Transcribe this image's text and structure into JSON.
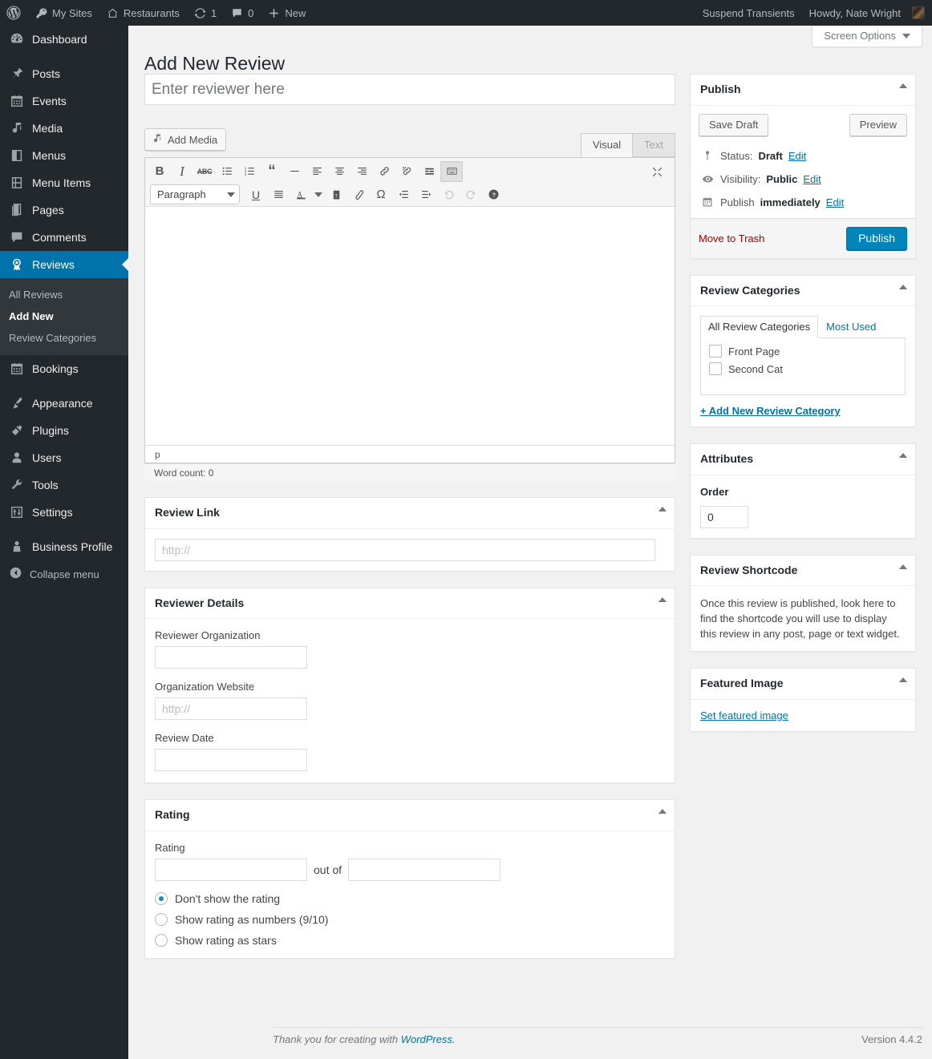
{
  "adminbar": {
    "logo_icon": "wordpress-logo-icon",
    "left_items": [
      {
        "label": "My Sites",
        "icon": "key-icon"
      },
      {
        "label": "Restaurants",
        "icon": "home-icon"
      },
      {
        "label": "1",
        "icon": "updates-icon"
      },
      {
        "label": "0",
        "icon": "comment-bubble-icon"
      },
      {
        "label": "New",
        "icon": "plus-icon"
      }
    ],
    "right_items": [
      {
        "label": "Suspend Transients"
      },
      {
        "label": "Howdy, Nate Wright"
      }
    ],
    "avatar_alt": "avatar"
  },
  "sidebar": {
    "items": [
      {
        "label": "Dashboard",
        "icon": "dashboard-icon",
        "current": false
      },
      {
        "label": "Posts",
        "icon": "pin-icon",
        "current": false
      },
      {
        "label": "Events",
        "icon": "calendar-icon",
        "current": false
      },
      {
        "label": "Media",
        "icon": "media-icon",
        "current": false
      },
      {
        "label": "Menus",
        "icon": "menus-icon",
        "current": false
      },
      {
        "label": "Menu Items",
        "icon": "menu-items-icon",
        "current": false
      },
      {
        "label": "Pages",
        "icon": "pages-icon",
        "current": false
      },
      {
        "label": "Comments",
        "icon": "comments-icon",
        "current": false
      },
      {
        "label": "Reviews",
        "icon": "award-icon",
        "current": true
      },
      {
        "label": "Bookings",
        "icon": "calendar-icon",
        "current": false
      },
      {
        "label": "Appearance",
        "icon": "brush-icon",
        "current": false
      },
      {
        "label": "Plugins",
        "icon": "plug-icon",
        "current": false
      },
      {
        "label": "Users",
        "icon": "user-icon",
        "current": false
      },
      {
        "label": "Tools",
        "icon": "wrench-icon",
        "current": false
      },
      {
        "label": "Settings",
        "icon": "settings-icon",
        "current": false
      },
      {
        "label": "Business Profile",
        "icon": "business-profile-icon",
        "current": false
      }
    ],
    "submenu": [
      {
        "label": "All Reviews",
        "current": false
      },
      {
        "label": "Add New",
        "current": true
      },
      {
        "label": "Review Categories",
        "current": false
      }
    ],
    "collapse_label": "Collapse menu",
    "collapse_icon": "collapse-arrow-icon"
  },
  "screen_meta": {
    "screen_options_label": "Screen Options"
  },
  "page": {
    "title": "Add New Review"
  },
  "title_field": {
    "placeholder": "Enter reviewer here",
    "value": ""
  },
  "editor": {
    "add_media_label": "Add Media",
    "add_media_icon": "media-icon",
    "tabs": [
      {
        "label": "Visual",
        "active": true
      },
      {
        "label": "Text",
        "active": false
      }
    ],
    "toolbar_row1": [
      {
        "icon": "bold-icon",
        "glyph": "B",
        "active": false
      },
      {
        "icon": "italic-icon",
        "glyph": "I",
        "active": false
      },
      {
        "icon": "strikethrough-icon",
        "glyph": "ABC",
        "active": false
      },
      {
        "icon": "bulleted-list-icon",
        "glyph": "",
        "active": false
      },
      {
        "icon": "numbered-list-icon",
        "glyph": "",
        "active": false
      },
      {
        "icon": "blockquote-icon",
        "glyph": "“",
        "active": false
      },
      {
        "icon": "horizontal-rule-icon",
        "glyph": "—",
        "active": false
      },
      {
        "icon": "align-left-icon",
        "glyph": "",
        "active": false
      },
      {
        "icon": "align-center-icon",
        "glyph": "",
        "active": false
      },
      {
        "icon": "align-right-icon",
        "glyph": "",
        "active": false
      },
      {
        "icon": "insert-link-icon",
        "glyph": "",
        "active": false
      },
      {
        "icon": "unlink-icon",
        "glyph": "",
        "active": false
      },
      {
        "icon": "read-more-icon",
        "glyph": "",
        "active": false
      },
      {
        "icon": "toggle-toolbar-icon",
        "glyph": "",
        "active": true
      }
    ],
    "format_select": {
      "value": "Paragraph"
    },
    "toolbar_row2": [
      {
        "icon": "underline-icon",
        "glyph": "U",
        "disabled": false
      },
      {
        "icon": "justify-icon",
        "glyph": "",
        "disabled": false
      },
      {
        "icon": "text-color-icon",
        "glyph": "A",
        "disabled": false
      },
      {
        "icon": "text-color-dropdown-icon",
        "glyph": "",
        "disabled": false
      },
      {
        "icon": "paste-as-text-icon",
        "glyph": "",
        "disabled": false
      },
      {
        "icon": "clear-formatting-icon",
        "glyph": "",
        "disabled": false
      },
      {
        "icon": "special-character-icon",
        "glyph": "Ω",
        "disabled": false
      },
      {
        "icon": "outdent-icon",
        "glyph": "",
        "disabled": false
      },
      {
        "icon": "indent-icon",
        "glyph": "",
        "disabled": false
      },
      {
        "icon": "undo-icon",
        "glyph": "",
        "disabled": true
      },
      {
        "icon": "redo-icon",
        "glyph": "",
        "disabled": true
      },
      {
        "icon": "keyboard-shortcuts-icon",
        "glyph": "?",
        "disabled": false
      }
    ],
    "fullscreen_icon": "fullscreen-icon",
    "path_indicator": "p",
    "word_count": "Word count: 0"
  },
  "review_link_box": {
    "title": "Review Link",
    "input": {
      "placeholder": "http://",
      "value": ""
    }
  },
  "reviewer_details_box": {
    "title": "Reviewer Details",
    "fields": [
      {
        "label": "Reviewer Organization",
        "placeholder": "",
        "value": ""
      },
      {
        "label": "Organization Website",
        "placeholder": "http://",
        "value": ""
      },
      {
        "label": "Review Date",
        "placeholder": "",
        "value": ""
      }
    ]
  },
  "rating_box": {
    "title": "Rating",
    "label": "Rating",
    "rating_value": "",
    "out_of_text": "out of",
    "out_of_value": "",
    "options": [
      {
        "label": "Don't show the rating",
        "checked": true
      },
      {
        "label": "Show rating as numbers (9/10)",
        "checked": false
      },
      {
        "label": "Show rating as stars",
        "checked": false
      }
    ]
  },
  "publish_box": {
    "title": "Publish",
    "save_draft_label": "Save Draft",
    "preview_label": "Preview",
    "status_prefix": "Status:",
    "status_value": "Draft",
    "status_edit": "Edit",
    "status_icon": "post-status-icon",
    "visibility_prefix": "Visibility:",
    "visibility_value": "Public",
    "visibility_edit": "Edit",
    "visibility_icon": "eye-icon",
    "schedule_prefix": "Publish",
    "schedule_value": "immediately",
    "schedule_edit": "Edit",
    "schedule_icon": "calendar-icon",
    "trash_label": "Move to Trash",
    "publish_label": "Publish"
  },
  "categories_box": {
    "title": "Review Categories",
    "tabs": [
      {
        "label": "All Review Categories",
        "active": true
      },
      {
        "label": "Most Used",
        "active": false
      }
    ],
    "items": [
      {
        "label": "Front Page",
        "checked": false
      },
      {
        "label": "Second Cat",
        "checked": false
      }
    ],
    "add_link": "+ Add New Review Category"
  },
  "attributes_box": {
    "title": "Attributes",
    "order_label": "Order",
    "order_value": "0"
  },
  "shortcode_box": {
    "title": "Review Shortcode",
    "text": "Once this review is published, look here to find the shortcode you will use to display this review in any post, page or text widget."
  },
  "featured_image_box": {
    "title": "Featured Image",
    "link_label": "Set featured image"
  },
  "footer": {
    "thanks_prefix": "Thank you for creating with ",
    "wordpress_label": "WordPress.",
    "version": "Version 4.4.2"
  },
  "colors": {
    "accent": "#0073aa",
    "publish_button": "#0085ba",
    "sidebar_bg": "#23282d",
    "submenu_bg": "#32373c",
    "trash_red": "#a00"
  }
}
